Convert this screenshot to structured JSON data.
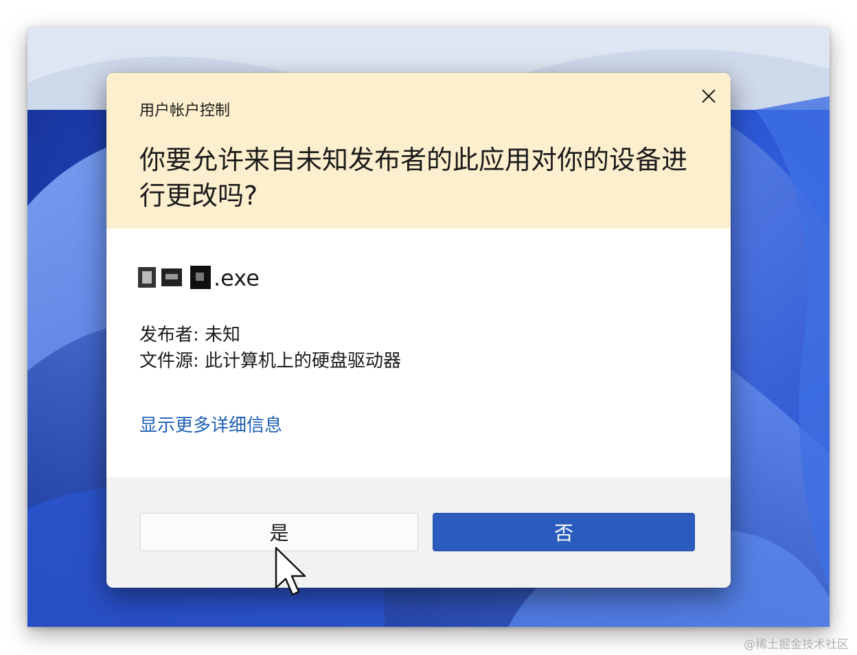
{
  "dialog": {
    "title": "用户帐户控制",
    "question": "你要允许来自未知发布者的此应用对你的设备进行更改吗?",
    "app_name_suffix": ".exe",
    "publisher_line": "发布者: 未知",
    "source_line": "文件源: 此计算机上的硬盘驱动器",
    "more_details_link": "显示更多详细信息",
    "yes_label": "是",
    "no_label": "否"
  },
  "watermark": "@稀土掘金技术社区",
  "colors": {
    "header_bg": "#fcefce",
    "link": "#1d5fb4",
    "primary_button": "#2a5bbd",
    "footer_bg": "#f2f2f2"
  }
}
